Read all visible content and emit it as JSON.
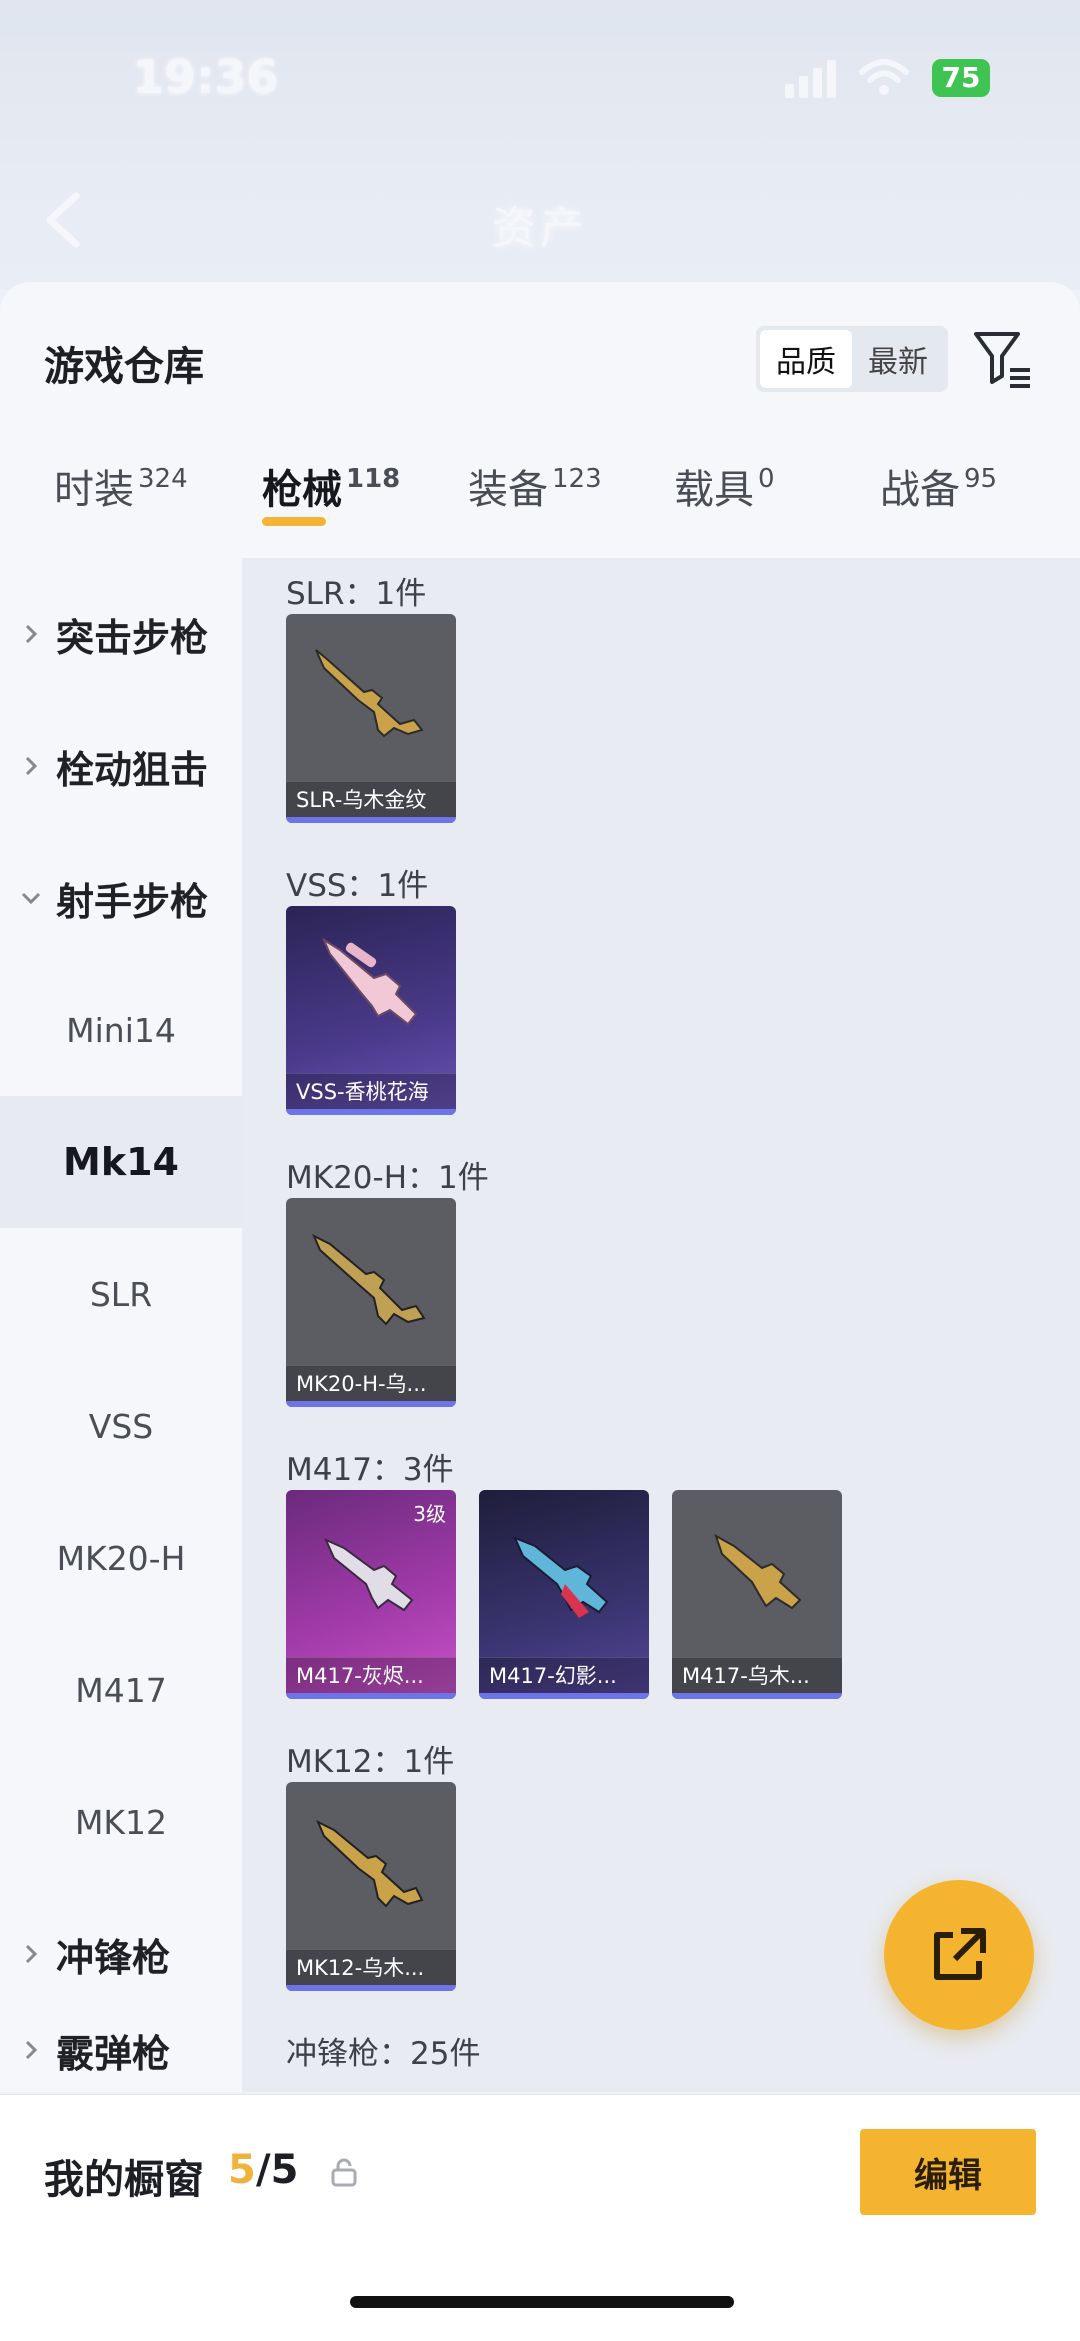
{
  "status": {
    "time": "19:36",
    "battery": "75"
  },
  "header": {
    "title": "资产"
  },
  "sheet": {
    "title": "游戏仓库",
    "sort_options": [
      "品质",
      "最新"
    ],
    "tabs": [
      {
        "label": "时装",
        "count": "324"
      },
      {
        "label": "枪械",
        "count": "118"
      },
      {
        "label": "装备",
        "count": "123"
      },
      {
        "label": "载具",
        "count": "0"
      },
      {
        "label": "战备",
        "count": "95"
      }
    ]
  },
  "sidebar": {
    "items": [
      "突击步枪",
      "栓动狙击",
      "射手步枪",
      "Mini14",
      "Mk14",
      "SLR",
      "VSS",
      "MK20-H",
      "M417",
      "MK12",
      "冲锋枪",
      "霰弹枪"
    ]
  },
  "content": {
    "groups": [
      {
        "label": "SLR：1件",
        "items": [
          {
            "name": "SLR-乌木金纹"
          }
        ]
      },
      {
        "label": "VSS：1件",
        "items": [
          {
            "name": "VSS-香桃花海"
          }
        ]
      },
      {
        "label": "MK20-H：1件",
        "items": [
          {
            "name": "MK20-H-乌..."
          }
        ]
      },
      {
        "label": "M417：3件",
        "items": [
          {
            "name": "M417-灰烬...",
            "level": "3级"
          },
          {
            "name": "M417-幻影..."
          },
          {
            "name": "M417-乌木..."
          }
        ]
      },
      {
        "label": "MK12：1件",
        "items": [
          {
            "name": "MK12-乌木..."
          }
        ]
      },
      {
        "label": "冲锋枪：25件"
      }
    ]
  },
  "bottom": {
    "label": "我的橱窗",
    "used": "5",
    "total": "/5",
    "edit_label": "编辑"
  },
  "colors": {
    "accent": "#f5b430",
    "rarity_bar": "#6c74e8"
  }
}
